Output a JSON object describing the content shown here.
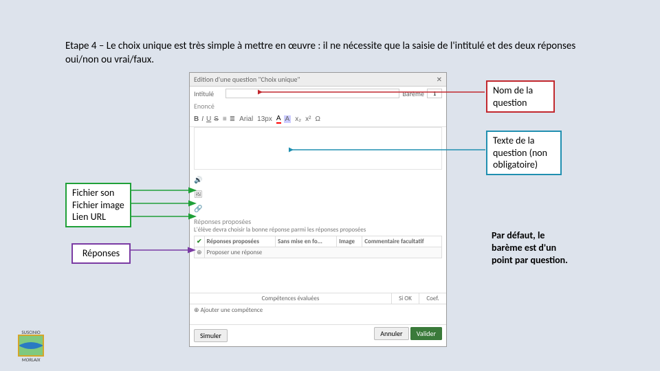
{
  "heading": "Etape 4 – Le choix unique est très simple à mettre en œuvre : il ne nécessite que la saisie de l'intitulé et des deux réponses oui/non ou vrai/faux.",
  "callouts": {
    "nom": "Nom de la question",
    "texte": "Texte de la question (non obligatoire)",
    "media_l1": "Fichier son",
    "media_l2": "Fichier image",
    "media_l3": "Lien URL",
    "reponses": "Réponses"
  },
  "note": "Par défaut, le barème est d'un point par question.",
  "dialog": {
    "title": "Edition d'une question \"Choix unique\"",
    "close": "✕",
    "intitule_label": "Intitulé",
    "bareme_label": "Barème",
    "bareme_value": "1",
    "enonce_label": "Enoncé",
    "toolbar": {
      "bold": "B",
      "italic": "I",
      "underline": "U",
      "strike": "S",
      "list_b": "≡",
      "list_n": "≣",
      "font": "Arial",
      "size": "13px",
      "color": "A",
      "bgcolor": "A",
      "sub": "x₂",
      "sup": "x²",
      "omega": "Ω"
    },
    "media": {
      "sound": "🔊",
      "image": "🖼",
      "link": "🔗"
    },
    "answers_section": "Réponses proposées",
    "answers_hint": "L'élève devra choisir la bonne réponse parmi les réponses proposées",
    "table": {
      "h1": "",
      "h2": "Réponses proposées",
      "h3": "Sans mise en fo...",
      "h4": "Image",
      "h5": "Commentaire facultatif",
      "placeholder": "Proposer une réponse"
    },
    "competences_label": "Compétences évaluées",
    "siok": "Si OK",
    "coef": "Coef.",
    "add_comp": "⊕ Ajouter une compétence",
    "simulate": "Simuler",
    "cancel": "Annuler",
    "validate": "Valider"
  },
  "logo": {
    "line1": "SUSCINIO",
    "line2": "MORLAIX"
  }
}
